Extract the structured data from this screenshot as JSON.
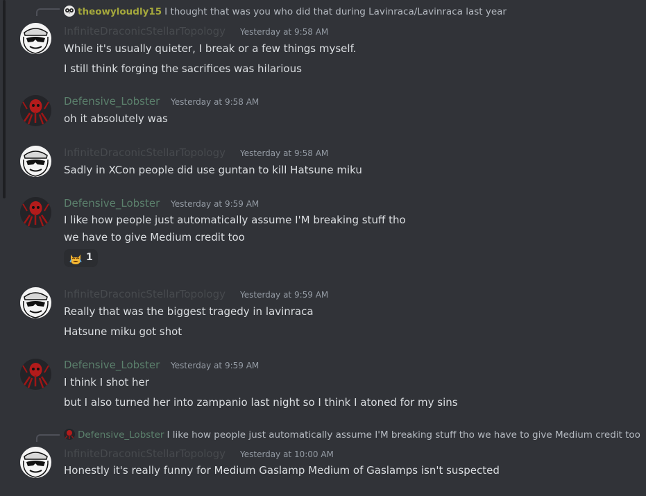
{
  "colors": {
    "background": "#313338",
    "username_infinite": "#474a4e",
    "username_lobster": "#5b806c",
    "username_owly": "#a5a83c",
    "timestamp": "#949ba4",
    "text": "#dbdee1"
  },
  "reply_top": {
    "author": "theowyloudly15",
    "text": "I thought that was you who did that during Lavinraca/Lavinraca last year",
    "avatar_icon": "owl-avatar-icon"
  },
  "messages": [
    {
      "author": "InfiniteDraconicStellarTopology",
      "timestamp": "Yesterday at 9:58 AM",
      "avatar_icon": "sunglasses-face-avatar-icon",
      "lines": [
        "While it's usually quieter, I break or a few things myself.",
        "I still think forging the sacrifices was hilarious"
      ]
    },
    {
      "author": "Defensive_Lobster",
      "timestamp": "Yesterday at 9:58 AM",
      "avatar_icon": "red-lobster-avatar-icon",
      "lines": [
        "oh it absolutely was"
      ]
    },
    {
      "author": "InfiniteDraconicStellarTopology",
      "timestamp": "Yesterday at 9:58 AM",
      "avatar_icon": "sunglasses-face-avatar-icon",
      "lines": [
        "Sadly in XCon people did use guntan to kill Hatsune miku"
      ]
    },
    {
      "author": "Defensive_Lobster",
      "timestamp": "Yesterday at 9:59 AM",
      "avatar_icon": "red-lobster-avatar-icon",
      "lines": [
        "I like how people just automatically assume I'M breaking stuff tho",
        "we have to give Medium credit too"
      ],
      "reaction": {
        "emoji_icon": "joy-cat-emoji-icon",
        "count": "1"
      }
    },
    {
      "author": "InfiniteDraconicStellarTopology",
      "timestamp": "Yesterday at 9:59 AM",
      "avatar_icon": "sunglasses-face-avatar-icon",
      "lines": [
        "Really that was the biggest tragedy in lavinraca",
        "Hatsune miku got shot"
      ]
    },
    {
      "author": "Defensive_Lobster",
      "timestamp": "Yesterday at 9:59 AM",
      "avatar_icon": "red-lobster-avatar-icon",
      "lines": [
        "I think I shot her",
        "but I also turned her into zampanio last night so I think I atoned for my sins"
      ]
    },
    {
      "author": "InfiniteDraconicStellarTopology",
      "timestamp": "Yesterday at 10:00 AM",
      "avatar_icon": "sunglasses-face-avatar-icon",
      "lines": [
        "Honestly it's really funny for Medium Gaslamp Medium of Gaslamps isn't suspected"
      ],
      "reply": {
        "author": "Defensive_Lobster",
        "text": "I like how people just automatically assume I'M breaking stuff tho we have to give Medium credit too"
      }
    }
  ]
}
